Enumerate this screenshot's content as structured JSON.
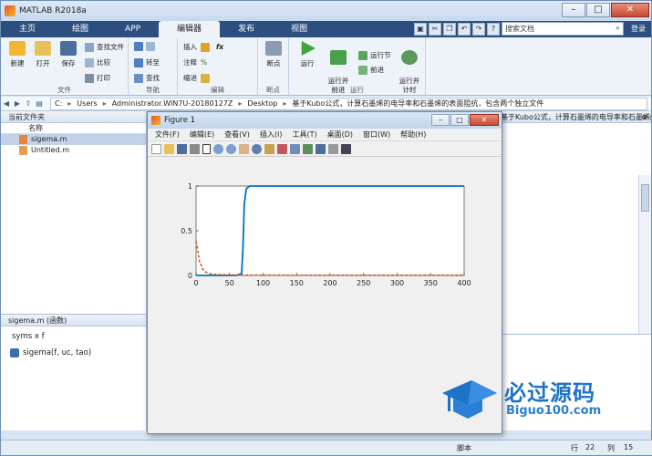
{
  "window": {
    "title": "MATLAB R2018a"
  },
  "tabs": [
    "主页",
    "绘图",
    "APP",
    "编辑器",
    "发布",
    "视图"
  ],
  "active_tab": "编辑器",
  "search": {
    "placeholder": "搜索文档"
  },
  "login_label": "登录",
  "ribbon": {
    "file": {
      "label": "文件",
      "new": "新建",
      "open": "打开",
      "save": "保存",
      "find_files": "查找文件",
      "compare": "比较",
      "print": "打印"
    },
    "navigate": {
      "label": "导航",
      "goto": "转至",
      "find": "查找"
    },
    "edit": {
      "label": "编辑",
      "insert": "插入",
      "comment": "注释",
      "indent": "缩进",
      "fx": "fx"
    },
    "breakpoints": {
      "label": "断点",
      "breakpoints": "断点"
    },
    "run": {
      "label": "运行",
      "run": "运行",
      "run_advance": "运行并\n前进",
      "run_section": "运行节",
      "advance": "前进",
      "run_time": "运行并\n计时"
    }
  },
  "address": {
    "crumbs": [
      "C:",
      "Users",
      "Administrator.WIN7U-20180127Z",
      "Desktop",
      "基于Kubo公式，计算石墨烯的电导率和石墨烯的表面阻抗，包含两个独立文件"
    ]
  },
  "current_folder": {
    "title": "当前文件夹",
    "column": "名称",
    "files": [
      {
        "name": "sigema.m",
        "selected": true
      },
      {
        "name": "Untitled.m",
        "selected": false
      }
    ]
  },
  "details": {
    "header": "sigema.m  (函数)",
    "line1": "syms x f",
    "func": "sigema(f, uc, tao)"
  },
  "editor": {
    "header": "基于Kubo公式，计算石墨烯的电导率和石墨烯的表面阻抗，包含两个独立文件"
  },
  "status": {
    "script": "脚本",
    "row_label": "行",
    "row": "22",
    "col_label": "列",
    "col": "15"
  },
  "figure": {
    "title": "Figure 1",
    "menu": [
      "文件(F)",
      "编辑(E)",
      "查看(V)",
      "插入(I)",
      "工具(T)",
      "桌面(D)",
      "窗口(W)",
      "帮助(H)"
    ]
  },
  "chart_data": {
    "type": "line",
    "title": "",
    "xlabel": "",
    "ylabel": "",
    "xlim": [
      0,
      400
    ],
    "ylim": [
      0,
      1
    ],
    "xticks": [
      0,
      50,
      100,
      150,
      200,
      250,
      300,
      350,
      400
    ],
    "yticks": [
      0,
      0.5,
      1
    ],
    "series": [
      {
        "style": "solid",
        "color": "#0072bd",
        "x": [
          0,
          60,
          68,
          70,
          72,
          75,
          80,
          100,
          150,
          400
        ],
        "y": [
          0,
          0,
          0.02,
          0.3,
          0.8,
          0.97,
          1,
          1,
          1,
          1
        ]
      },
      {
        "style": "dashed",
        "color": "#d95319",
        "x": [
          0,
          2,
          5,
          10,
          15,
          20,
          30,
          45,
          60,
          100,
          200,
          300,
          400
        ],
        "y": [
          0.38,
          0.3,
          0.16,
          0.07,
          0.035,
          0.02,
          0.01,
          0.006,
          0.004,
          0.003,
          0.002,
          0.002,
          0.002
        ]
      }
    ],
    "grid": false
  },
  "watermark": {
    "text1": "必过源码",
    "text2": "Biguo100.com"
  }
}
